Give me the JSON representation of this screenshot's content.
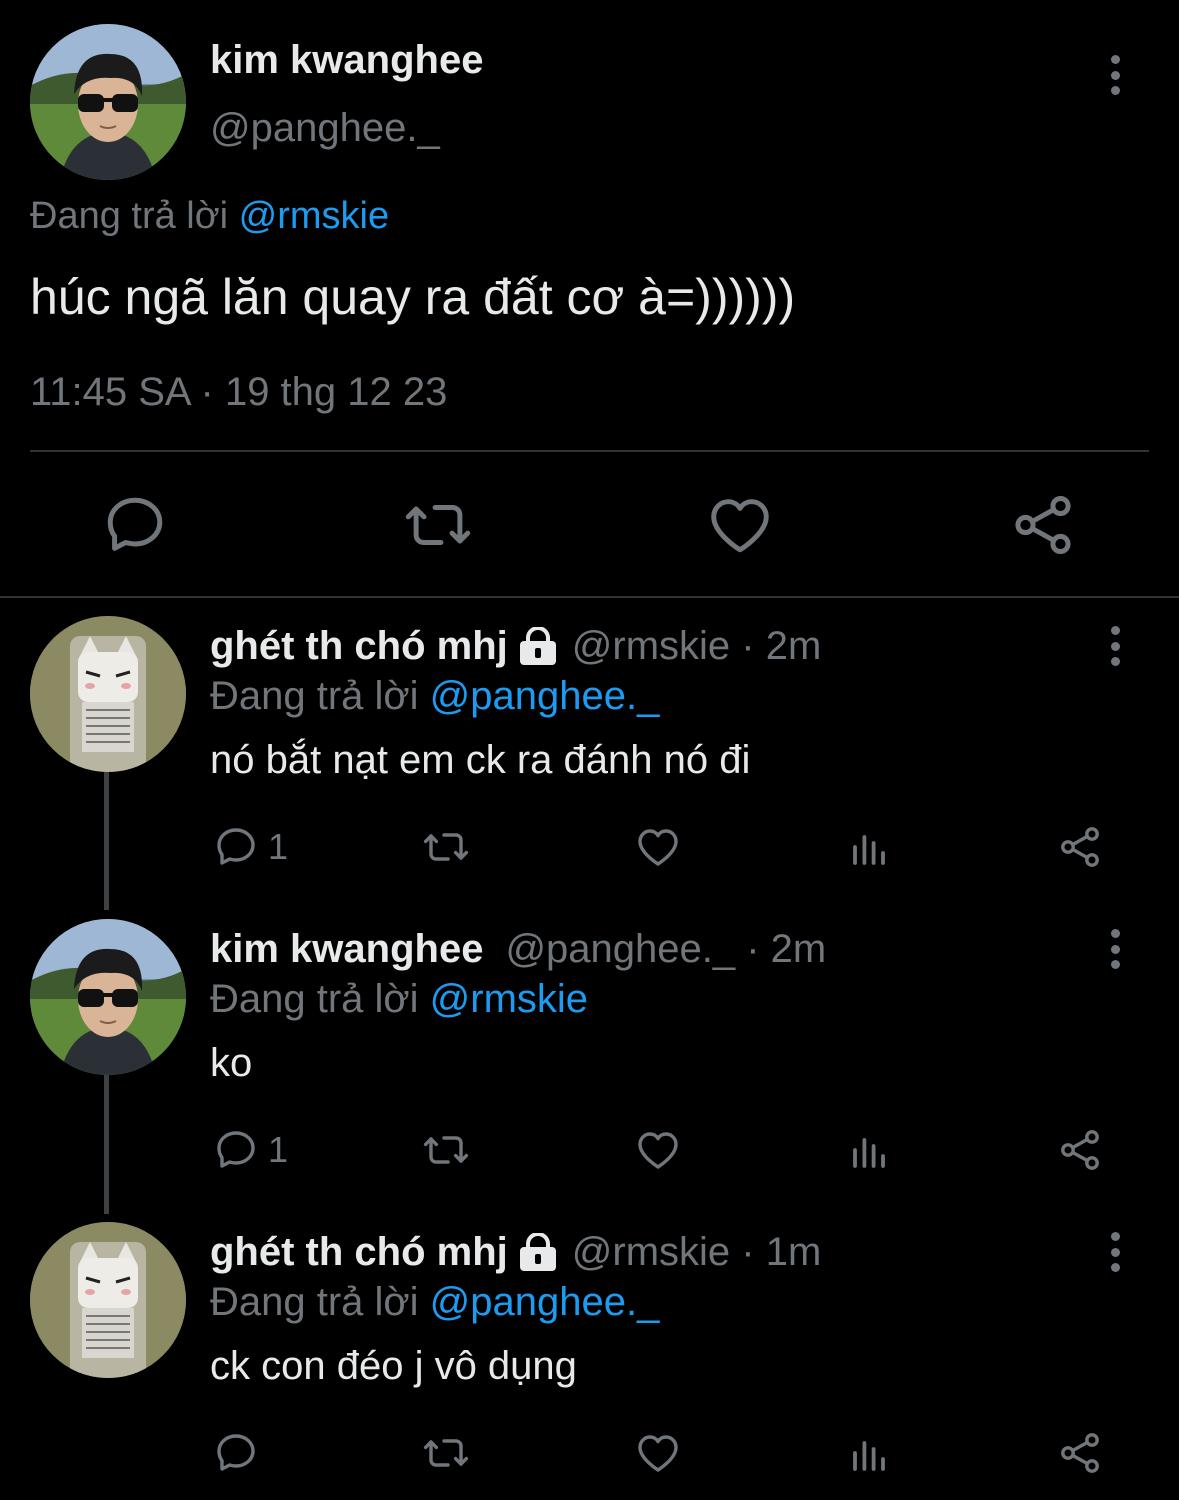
{
  "main_tweet": {
    "author_name": "kim kwanghee",
    "author_handle": "@panghee._",
    "replying_prefix": "Đang trả lời ",
    "replying_to": "@rmskie",
    "text": "húc ngã lăn quay ra đất cơ à=))))))",
    "timestamp": "11:45 SA · 19 thg 12 23",
    "actions": [
      "reply-icon",
      "retweet-icon",
      "like-icon",
      "share-icon"
    ]
  },
  "replies": [
    {
      "author_name": "ghét th chó mhj",
      "protected": true,
      "handle_time": "@rmskie · 2m",
      "replying_prefix": "Đang trả lời ",
      "replying_to": "@panghee._",
      "text": "nó bắt nạt em ck ra đánh nó đi",
      "reply_count": "1"
    },
    {
      "author_name": "kim kwanghee",
      "protected": false,
      "handle_time": "@panghee._ · 2m",
      "replying_prefix": "Đang trả lời ",
      "replying_to": "@rmskie",
      "text": "ko",
      "reply_count": "1"
    },
    {
      "author_name": "ghét th chó mhj",
      "protected": true,
      "handle_time": "@rmskie · 1m",
      "replying_prefix": "Đang trả lời ",
      "replying_to": "@panghee._",
      "text": "ck con đéo j vô dụng",
      "reply_count": ""
    }
  ],
  "colors": {
    "background": "#000000",
    "primary_text": "#e7e9ea",
    "secondary_text": "#71767b",
    "link": "#1d9bf0",
    "divider": "#2f3336"
  }
}
